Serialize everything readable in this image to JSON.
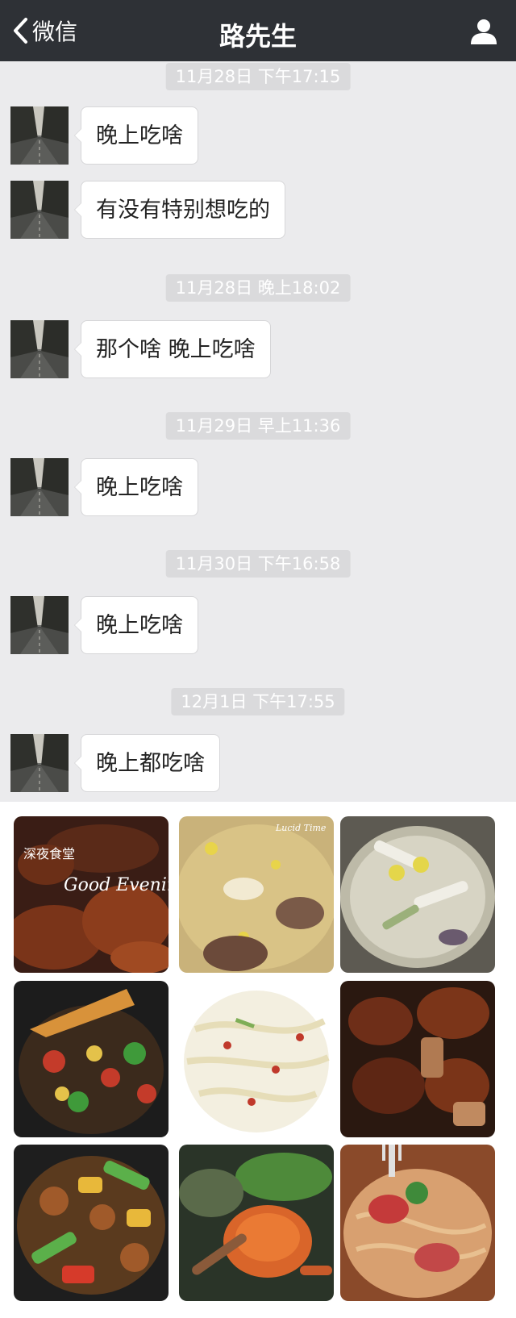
{
  "nav": {
    "back_label": "微信",
    "title": "路先生"
  },
  "chat": [
    {
      "timestamp": "11月28日 下午17:15",
      "messages": [
        "晚上吃啥",
        "有没有特别想吃的"
      ]
    },
    {
      "timestamp": "11月28日 晚上18:02",
      "messages": [
        "那个啥 晚上吃啥"
      ]
    },
    {
      "timestamp": "11月29日 早上11:36",
      "messages": [
        "晚上吃啥"
      ]
    },
    {
      "timestamp": "11月30日 下午16:58",
      "messages": [
        "晚上吃啥"
      ]
    },
    {
      "timestamp": "12月1日 下午17:55",
      "messages": [
        "晚上都吃啥"
      ]
    }
  ],
  "food_images": {
    "overlay_text_1": "深夜食堂",
    "overlay_text_2": "Good Evening!",
    "overlay_text_3": "Lucid Time"
  },
  "colors": {
    "navbar": "#2e3136",
    "chat_background": "#ebebed",
    "timestamp_background": "#dadadc",
    "bubble": "#ffffff"
  }
}
